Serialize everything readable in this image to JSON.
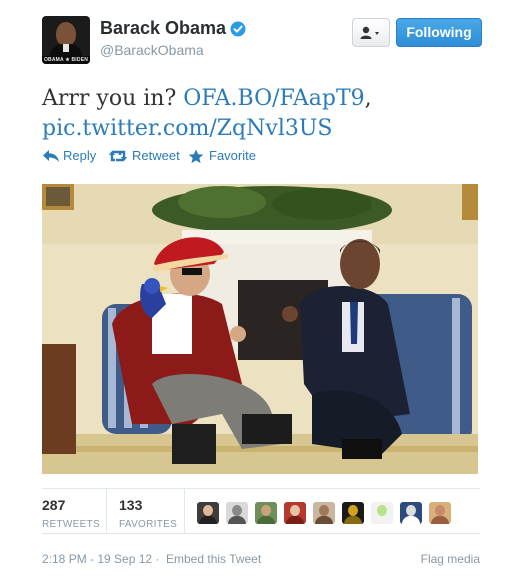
{
  "header": {
    "avatar_caption": "OBAMA ★ BIDEN",
    "fullname": "Barack Obama",
    "handle": "@BarackObama",
    "follow_label": "Following"
  },
  "tweet": {
    "text_before": "Arrr you in? ",
    "link1": "OFA.BO/FAapT9",
    "text_between": ",",
    "link2": "pic.twitter.com/ZqNvl3US"
  },
  "actions": {
    "reply": "Reply",
    "retweet": "Retweet",
    "favorite": "Favorite"
  },
  "photo": {
    "description_icon": "photo-pirate-oval-office"
  },
  "stats": {
    "retweets_count": "287",
    "retweets_label": "RETWEETS",
    "favorites_count": "133",
    "favorites_label": "FAVORITES",
    "faces": [
      {
        "bg": "#3d3d3d",
        "skin": "#e0b89a",
        "body": "#222222"
      },
      {
        "bg": "#d9d9d9",
        "skin": "#8a8a8a",
        "body": "#555555"
      },
      {
        "bg": "#6f8f5a",
        "skin": "#c9a27c",
        "body": "#4b6a3a"
      },
      {
        "bg": "#b33a2e",
        "skin": "#e8c4a5",
        "body": "#7a1f16"
      },
      {
        "bg": "#c9b7a0",
        "skin": "#a0785a",
        "body": "#6b4d36"
      },
      {
        "bg": "#1a1a1a",
        "skin": "#d4a020",
        "body": "#8a6a10"
      },
      {
        "bg": "#f2f2f2",
        "skin": "#b8e38a",
        "body": "#f2f2f2"
      },
      {
        "bg": "#2c4a7c",
        "skin": "#dddddd",
        "body": "#ffffff"
      },
      {
        "bg": "#d8b07a",
        "skin": "#c98a6a",
        "body": "#9a5f3e"
      }
    ]
  },
  "footer": {
    "timestamp": "2:18 PM - 19 Sep 12",
    "separator": "·",
    "embed": "Embed this Tweet",
    "flag": "Flag media"
  },
  "colors": {
    "link": "#2b7bb9",
    "follow_button": "#2f8ed6",
    "verified": "#2b9be6"
  }
}
